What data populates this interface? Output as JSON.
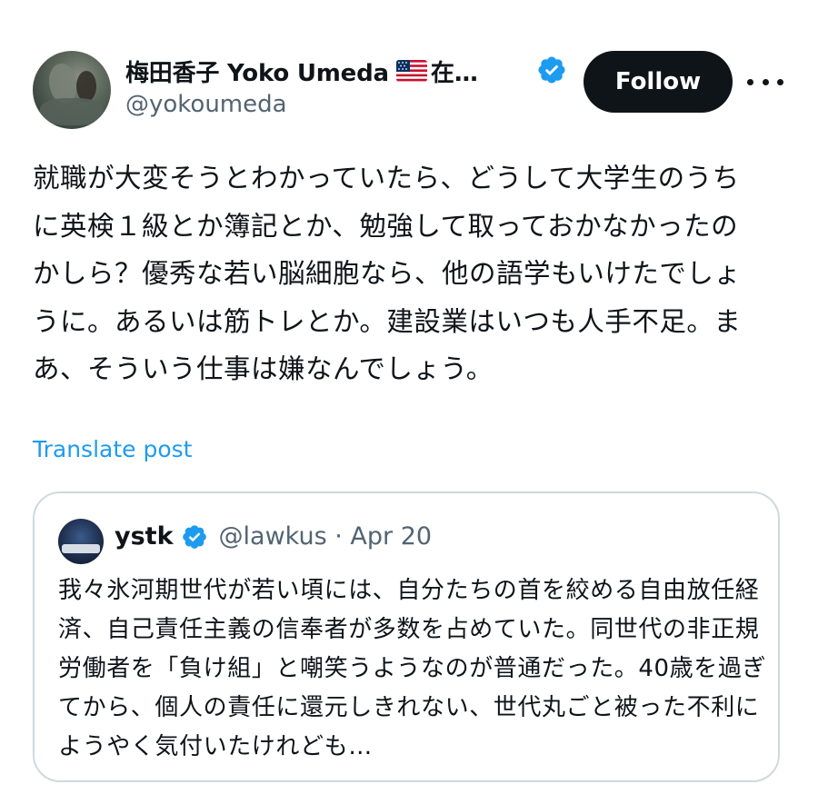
{
  "author": {
    "display_name": "梅田香子 Yoko Umeda",
    "name_suffix": "在…",
    "flag_icon": "us-flag-emoji",
    "handle": "@yokoumeda",
    "verified": true
  },
  "actions": {
    "follow_label": "Follow",
    "more_icon": "more-horizontal-icon"
  },
  "post": {
    "text": "就職が大変そうとわかっていたら、どうして大学生のうちに英検１級とか簿記とか、勉強して取っておかなかったのかしら？優秀な若い脳細胞なら、他の語学もいけたでしょうに。あるいは筋トレとか。建設業はいつも人手不足。まあ、そういう仕事は嫌なんでしょう。",
    "translate_label": "Translate post"
  },
  "quote": {
    "display_name": "ystk",
    "verified": true,
    "handle_date": "@lawkus · Apr 20",
    "text": "我々氷河期世代が若い頃には、自分たちの首を絞める自由放任経済、自己責任主義の信奉者が多数を占めていた。同世代の非正規労働者を「負け組」と嘲笑うようなのが普通だった。40歳を過ぎてから、個人の責任に還元しきれない、世代丸ごと被った不利にようやく気付いたけれども…"
  },
  "colors": {
    "text": "#0f1419",
    "secondary": "#536471",
    "link": "#1d9bf0",
    "verified": "#1d9bf0",
    "button_bg": "#0f1419",
    "border": "#cfd9de"
  }
}
